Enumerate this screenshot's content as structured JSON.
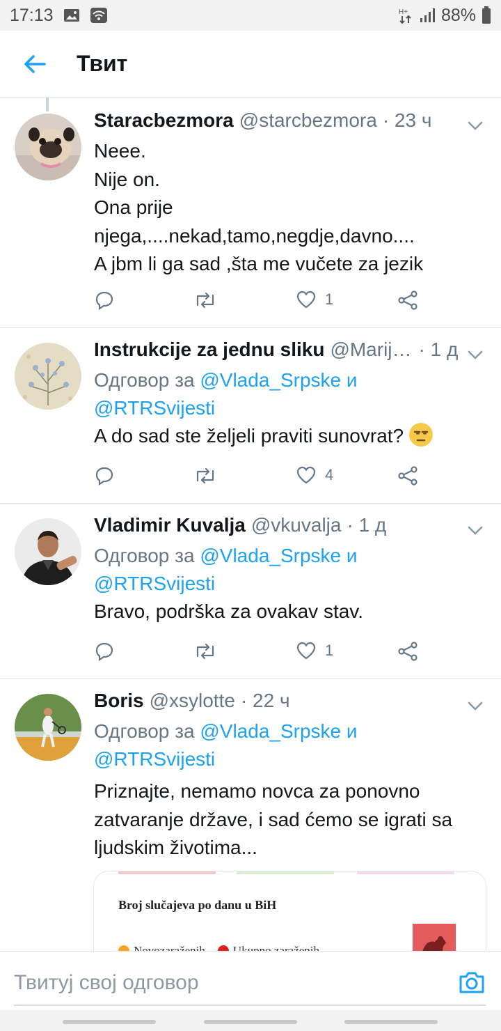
{
  "status_bar": {
    "time": "17:13",
    "battery": "88%"
  },
  "header": {
    "title": "Твит"
  },
  "tweets": [
    {
      "name": "Staracbezmora",
      "handle": "@starcbezmora",
      "time": "· 23 ч",
      "lines": [
        "Neee.",
        "Nije on.",
        "Ona prije",
        "njega,....nekad,tamo,negdje,davno....",
        "A jbm li ga sad ,šta me vučete za jezik"
      ],
      "likes": "1"
    },
    {
      "name": "Instrukcije za jednu sliku",
      "handle": "@Marij…",
      "time": "· 1 д",
      "reply_prefix": "Одговор за",
      "reply_user1": "@Vlada_Srpske",
      "reply_and": "и",
      "reply_user2": "@RTRSvijesti",
      "text": "A do sad ste željeli praviti sunovrat?",
      "likes": "4"
    },
    {
      "name": "Vladimir Kuvalja",
      "handle": "@vkuvalja",
      "time": "· 1 д",
      "reply_prefix": "Одговор за",
      "reply_user1": "@Vlada_Srpske",
      "reply_and": "и",
      "reply_user2": "@RTRSvijesti",
      "text": "Bravo, podrška za ovakav stav.",
      "likes": "1"
    },
    {
      "name": "Boris",
      "handle": "@xsylotte",
      "time": "· 22 ч",
      "reply_prefix": "Одговор за",
      "reply_user1": "@Vlada_Srpske",
      "reply_and": "и",
      "reply_user2": "@RTRSvijesti",
      "lines": [
        "Priznajte, nemamo novca za ponovno",
        "zatvaranje države, i sad ćemo se igrati sa",
        "ljudskim životima..."
      ],
      "card": {
        "title": "Broj slučajeva po danu u BiH",
        "legend1": "Novozaraženih",
        "legend2": "Ukupno zaraženih"
      }
    }
  ],
  "compose": {
    "placeholder": "Твитуј свој одговор"
  },
  "colors": {
    "accent": "#1da1f2",
    "secondary_text": "#657786",
    "divider": "#e1e8ed"
  }
}
